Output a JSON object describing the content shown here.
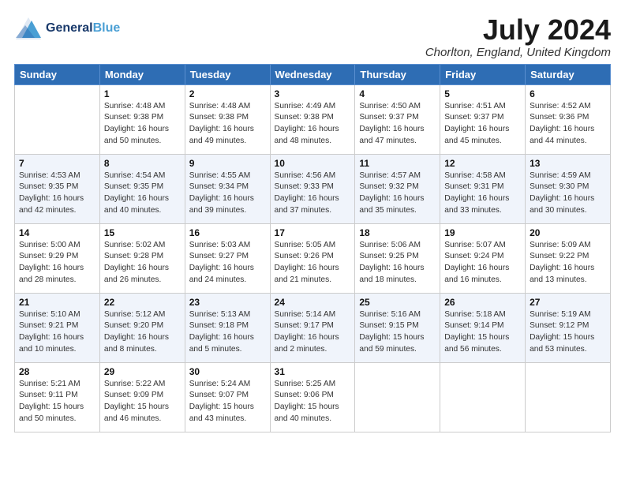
{
  "header": {
    "logo_general": "General",
    "logo_blue": "Blue",
    "month_title": "July 2024",
    "location": "Chorlton, England, United Kingdom"
  },
  "days_of_week": [
    "Sunday",
    "Monday",
    "Tuesday",
    "Wednesday",
    "Thursday",
    "Friday",
    "Saturday"
  ],
  "weeks": [
    [
      {
        "day": "",
        "info": ""
      },
      {
        "day": "1",
        "info": "Sunrise: 4:48 AM\nSunset: 9:38 PM\nDaylight: 16 hours\nand 50 minutes."
      },
      {
        "day": "2",
        "info": "Sunrise: 4:48 AM\nSunset: 9:38 PM\nDaylight: 16 hours\nand 49 minutes."
      },
      {
        "day": "3",
        "info": "Sunrise: 4:49 AM\nSunset: 9:38 PM\nDaylight: 16 hours\nand 48 minutes."
      },
      {
        "day": "4",
        "info": "Sunrise: 4:50 AM\nSunset: 9:37 PM\nDaylight: 16 hours\nand 47 minutes."
      },
      {
        "day": "5",
        "info": "Sunrise: 4:51 AM\nSunset: 9:37 PM\nDaylight: 16 hours\nand 45 minutes."
      },
      {
        "day": "6",
        "info": "Sunrise: 4:52 AM\nSunset: 9:36 PM\nDaylight: 16 hours\nand 44 minutes."
      }
    ],
    [
      {
        "day": "7",
        "info": "Sunrise: 4:53 AM\nSunset: 9:35 PM\nDaylight: 16 hours\nand 42 minutes."
      },
      {
        "day": "8",
        "info": "Sunrise: 4:54 AM\nSunset: 9:35 PM\nDaylight: 16 hours\nand 40 minutes."
      },
      {
        "day": "9",
        "info": "Sunrise: 4:55 AM\nSunset: 9:34 PM\nDaylight: 16 hours\nand 39 minutes."
      },
      {
        "day": "10",
        "info": "Sunrise: 4:56 AM\nSunset: 9:33 PM\nDaylight: 16 hours\nand 37 minutes."
      },
      {
        "day": "11",
        "info": "Sunrise: 4:57 AM\nSunset: 9:32 PM\nDaylight: 16 hours\nand 35 minutes."
      },
      {
        "day": "12",
        "info": "Sunrise: 4:58 AM\nSunset: 9:31 PM\nDaylight: 16 hours\nand 33 minutes."
      },
      {
        "day": "13",
        "info": "Sunrise: 4:59 AM\nSunset: 9:30 PM\nDaylight: 16 hours\nand 30 minutes."
      }
    ],
    [
      {
        "day": "14",
        "info": "Sunrise: 5:00 AM\nSunset: 9:29 PM\nDaylight: 16 hours\nand 28 minutes."
      },
      {
        "day": "15",
        "info": "Sunrise: 5:02 AM\nSunset: 9:28 PM\nDaylight: 16 hours\nand 26 minutes."
      },
      {
        "day": "16",
        "info": "Sunrise: 5:03 AM\nSunset: 9:27 PM\nDaylight: 16 hours\nand 24 minutes."
      },
      {
        "day": "17",
        "info": "Sunrise: 5:05 AM\nSunset: 9:26 PM\nDaylight: 16 hours\nand 21 minutes."
      },
      {
        "day": "18",
        "info": "Sunrise: 5:06 AM\nSunset: 9:25 PM\nDaylight: 16 hours\nand 18 minutes."
      },
      {
        "day": "19",
        "info": "Sunrise: 5:07 AM\nSunset: 9:24 PM\nDaylight: 16 hours\nand 16 minutes."
      },
      {
        "day": "20",
        "info": "Sunrise: 5:09 AM\nSunset: 9:22 PM\nDaylight: 16 hours\nand 13 minutes."
      }
    ],
    [
      {
        "day": "21",
        "info": "Sunrise: 5:10 AM\nSunset: 9:21 PM\nDaylight: 16 hours\nand 10 minutes."
      },
      {
        "day": "22",
        "info": "Sunrise: 5:12 AM\nSunset: 9:20 PM\nDaylight: 16 hours\nand 8 minutes."
      },
      {
        "day": "23",
        "info": "Sunrise: 5:13 AM\nSunset: 9:18 PM\nDaylight: 16 hours\nand 5 minutes."
      },
      {
        "day": "24",
        "info": "Sunrise: 5:14 AM\nSunset: 9:17 PM\nDaylight: 16 hours\nand 2 minutes."
      },
      {
        "day": "25",
        "info": "Sunrise: 5:16 AM\nSunset: 9:15 PM\nDaylight: 15 hours\nand 59 minutes."
      },
      {
        "day": "26",
        "info": "Sunrise: 5:18 AM\nSunset: 9:14 PM\nDaylight: 15 hours\nand 56 minutes."
      },
      {
        "day": "27",
        "info": "Sunrise: 5:19 AM\nSunset: 9:12 PM\nDaylight: 15 hours\nand 53 minutes."
      }
    ],
    [
      {
        "day": "28",
        "info": "Sunrise: 5:21 AM\nSunset: 9:11 PM\nDaylight: 15 hours\nand 50 minutes."
      },
      {
        "day": "29",
        "info": "Sunrise: 5:22 AM\nSunset: 9:09 PM\nDaylight: 15 hours\nand 46 minutes."
      },
      {
        "day": "30",
        "info": "Sunrise: 5:24 AM\nSunset: 9:07 PM\nDaylight: 15 hours\nand 43 minutes."
      },
      {
        "day": "31",
        "info": "Sunrise: 5:25 AM\nSunset: 9:06 PM\nDaylight: 15 hours\nand 40 minutes."
      },
      {
        "day": "",
        "info": ""
      },
      {
        "day": "",
        "info": ""
      },
      {
        "day": "",
        "info": ""
      }
    ]
  ]
}
